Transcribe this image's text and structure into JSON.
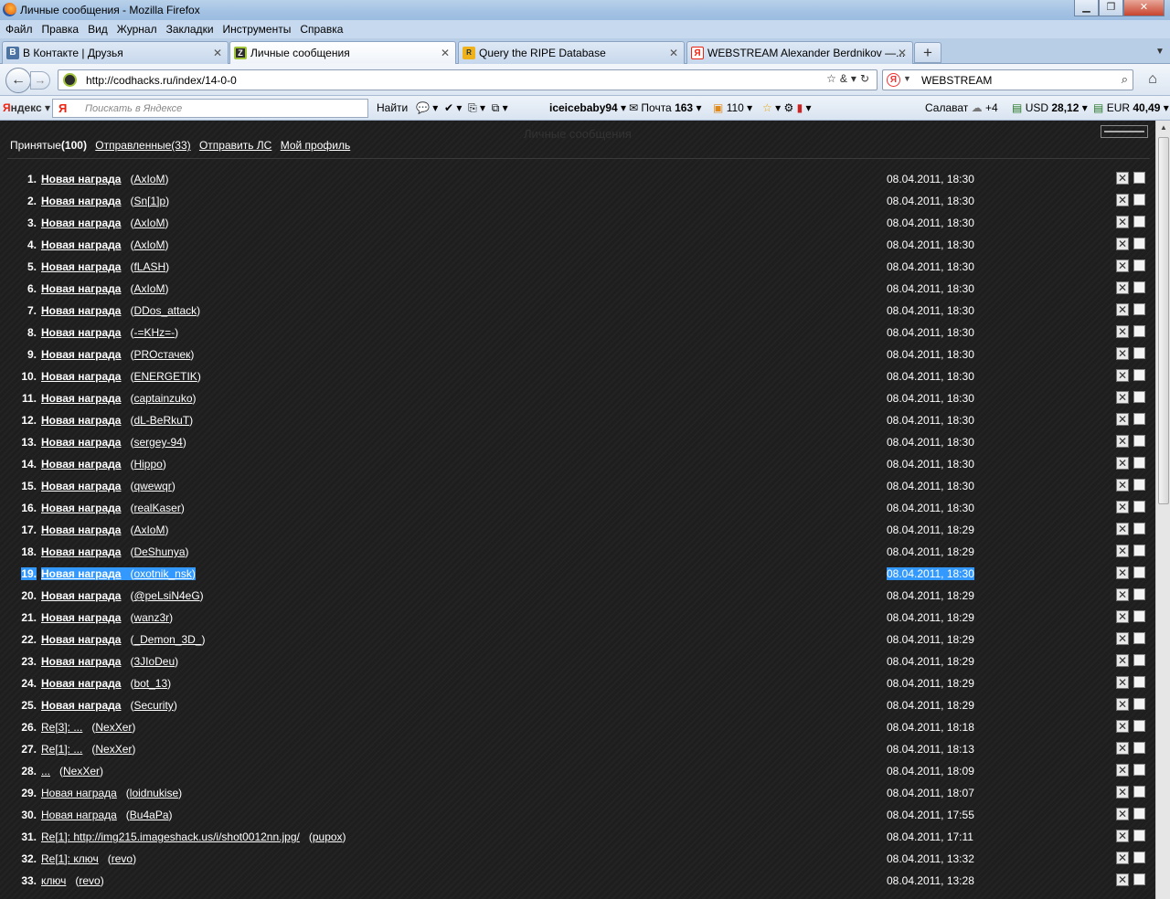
{
  "window": {
    "title": "Личные сообщения - Mozilla Firefox"
  },
  "menu": [
    "Файл",
    "Правка",
    "Вид",
    "Журнал",
    "Закладки",
    "Инструменты",
    "Справка"
  ],
  "tabs": [
    {
      "label": "В Контакте | Друзья",
      "icon_color": "#4b73a4",
      "icon_text": "B"
    },
    {
      "label": "Личные сообщения",
      "icon_color": "#2d2d2d",
      "icon_text": "Z",
      "active": true
    },
    {
      "label": "Query the RIPE Database",
      "icon_color": "#f0b21c",
      "icon_text": "R"
    },
    {
      "label": "WEBSTREAM Alexander Berdnikov —...",
      "icon_color": "#ffffff",
      "icon_text": "Я"
    }
  ],
  "nav": {
    "url": "http://codhacks.ru/index/14-0-0",
    "search_value": "WEBSTREAM"
  },
  "yandex": {
    "logo_prefix": "Я",
    "logo_rest": "ндекс",
    "search_placeholder": "Поискать в Яндексе",
    "find_label": "Найти",
    "user": "iceicebaby94",
    "mail_label": "Почта",
    "mail_count": "163",
    "notif_count": "110",
    "city": "Салават",
    "weather": "+4",
    "usd_label": "USD",
    "usd_value": "28,12",
    "eur_label": "EUR",
    "eur_value": "40,49"
  },
  "page": {
    "ghost_title": "Личные сообщения",
    "tab_received_label": "Принятые",
    "tab_received_count": "(100)",
    "tab_sent": "Отправленные(33)",
    "send_pm": "Отправить ЛС",
    "my_profile": "Мой профиль"
  },
  "messages": [
    {
      "num": "1.",
      "title": "Новая награда",
      "author": "AxIoM",
      "date": "08.04.2011, 18:30",
      "unread": true
    },
    {
      "num": "2.",
      "title": "Новая награда",
      "author": "Sn[1]p",
      "date": "08.04.2011, 18:30",
      "unread": true
    },
    {
      "num": "3.",
      "title": "Новая награда",
      "author": "AxIoM",
      "date": "08.04.2011, 18:30",
      "unread": true
    },
    {
      "num": "4.",
      "title": "Новая награда",
      "author": "AxIoM",
      "date": "08.04.2011, 18:30",
      "unread": true
    },
    {
      "num": "5.",
      "title": "Новая награда",
      "author": "fLASH",
      "date": "08.04.2011, 18:30",
      "unread": true
    },
    {
      "num": "6.",
      "title": "Новая награда",
      "author": "AxIoM",
      "date": "08.04.2011, 18:30",
      "unread": true
    },
    {
      "num": "7.",
      "title": "Новая награда",
      "author": "DDos_attack",
      "date": "08.04.2011, 18:30",
      "unread": true
    },
    {
      "num": "8.",
      "title": "Новая награда",
      "author": "-=KHz=-",
      "date": "08.04.2011, 18:30",
      "unread": true
    },
    {
      "num": "9.",
      "title": "Новая награда",
      "author": "PROстачек",
      "date": "08.04.2011, 18:30",
      "unread": true
    },
    {
      "num": "10.",
      "title": "Новая награда",
      "author": "ENERGETIK",
      "date": "08.04.2011, 18:30",
      "unread": true
    },
    {
      "num": "11.",
      "title": "Новая награда",
      "author": "captainzuko",
      "date": "08.04.2011, 18:30",
      "unread": true
    },
    {
      "num": "12.",
      "title": "Новая награда",
      "author": "dL-BeRkuT",
      "date": "08.04.2011, 18:30",
      "unread": true
    },
    {
      "num": "13.",
      "title": "Новая награда",
      "author": "sergey-94",
      "date": "08.04.2011, 18:30",
      "unread": true
    },
    {
      "num": "14.",
      "title": "Новая награда",
      "author": "Hippo",
      "date": "08.04.2011, 18:30",
      "unread": true
    },
    {
      "num": "15.",
      "title": "Новая награда",
      "author": "qwewqr",
      "date": "08.04.2011, 18:30",
      "unread": true
    },
    {
      "num": "16.",
      "title": "Новая награда",
      "author": "realKaser",
      "date": "08.04.2011, 18:30",
      "unread": true
    },
    {
      "num": "17.",
      "title": "Новая награда",
      "author": "AxIoM",
      "date": "08.04.2011, 18:29",
      "unread": true
    },
    {
      "num": "18.",
      "title": "Новая награда",
      "author": "DeShunya",
      "date": "08.04.2011, 18:29",
      "unread": true
    },
    {
      "num": "19.",
      "title": "Новая награда",
      "author": "oxotnik_nsk",
      "date": "08.04.2011, 18:30",
      "unread": true,
      "selected": true
    },
    {
      "num": "20.",
      "title": "Новая награда",
      "author": "@peLsiN4eG",
      "date": "08.04.2011, 18:29",
      "unread": true
    },
    {
      "num": "21.",
      "title": "Новая награда",
      "author": "wanz3r",
      "date": "08.04.2011, 18:29",
      "unread": true
    },
    {
      "num": "22.",
      "title": "Новая награда",
      "author": "_Demon_3D_",
      "date": "08.04.2011, 18:29",
      "unread": true
    },
    {
      "num": "23.",
      "title": "Новая награда",
      "author": "3JIoDeu",
      "date": "08.04.2011, 18:29",
      "unread": true
    },
    {
      "num": "24.",
      "title": "Новая награда",
      "author": "bot_13",
      "date": "08.04.2011, 18:29",
      "unread": true
    },
    {
      "num": "25.",
      "title": "Новая награда",
      "author": "Security",
      "date": "08.04.2011, 18:29",
      "unread": true
    },
    {
      "num": "26.",
      "title": "Re[3]: ...",
      "author": "NexXer",
      "date": "08.04.2011, 18:18",
      "unread": false
    },
    {
      "num": "27.",
      "title": "Re[1]: ...",
      "author": "NexXer",
      "date": "08.04.2011, 18:13",
      "unread": false
    },
    {
      "num": "28.",
      "title": "...",
      "author": "NexXer",
      "date": "08.04.2011, 18:09",
      "unread": false
    },
    {
      "num": "29.",
      "title": "Новая награда",
      "author": "loidnukise",
      "date": "08.04.2011, 18:07",
      "unread": false
    },
    {
      "num": "30.",
      "title": "Новая награда",
      "author": "Bu4aPa",
      "date": "08.04.2011, 17:55",
      "unread": false
    },
    {
      "num": "31.",
      "title": "Re[1]: http://img215.imageshack.us/i/shot0012nn.jpg/",
      "author": "pupox",
      "date": "08.04.2011, 17:11",
      "unread": false
    },
    {
      "num": "32.",
      "title": "Re[1]: ключ",
      "author": "revo",
      "date": "08.04.2011, 13:32",
      "unread": false
    },
    {
      "num": "33.",
      "title": "ключ",
      "author": "revo",
      "date": "08.04.2011, 13:28",
      "unread": false
    }
  ]
}
